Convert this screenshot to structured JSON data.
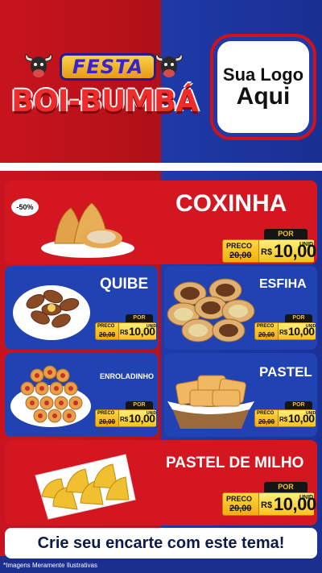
{
  "header": {
    "festa": "FESTA",
    "title": "BOI-BUMBÁ",
    "logo_line1": "Sua Logo",
    "logo_line2": "Aqui"
  },
  "products": [
    {
      "name": "COXINHA",
      "badge": "-50%",
      "preco_label": "PRECO",
      "old_price": "20,00",
      "por_label": "POR",
      "currency": "R$",
      "price": "10,00",
      "unit": "UNID"
    },
    {
      "name": "QUIBE",
      "preco_label": "PRECO",
      "old_price": "20,00",
      "por_label": "POR",
      "currency": "R$",
      "price": "10,00",
      "unit": "UNID"
    },
    {
      "name": "ESFIHA",
      "preco_label": "PRECO",
      "old_price": "20,00",
      "por_label": "POR",
      "currency": "R$",
      "price": "10,00",
      "unit": "UNID"
    },
    {
      "name": "ENROLADINHO",
      "preco_label": "PRECO",
      "old_price": "20,00",
      "por_label": "POR",
      "currency": "R$",
      "price": "10,00",
      "unit": "UNID"
    },
    {
      "name": "PASTEL",
      "preco_label": "PRECO",
      "old_price": "20,00",
      "por_label": "POR",
      "currency": "R$",
      "price": "10,00",
      "unit": "UNID"
    },
    {
      "name": "PASTEL DE MILHO",
      "preco_label": "PRECO",
      "old_price": "20,00",
      "por_label": "POR",
      "currency": "R$",
      "price": "10,00",
      "unit": "UNID"
    }
  ],
  "cta": "Crie seu encarte com este tema!",
  "disclaimer": "*Imagens Meramente Ilustrativas",
  "colors": {
    "red": "#d3161f",
    "blue": "#2142b3",
    "gold": "#f2c02a"
  }
}
